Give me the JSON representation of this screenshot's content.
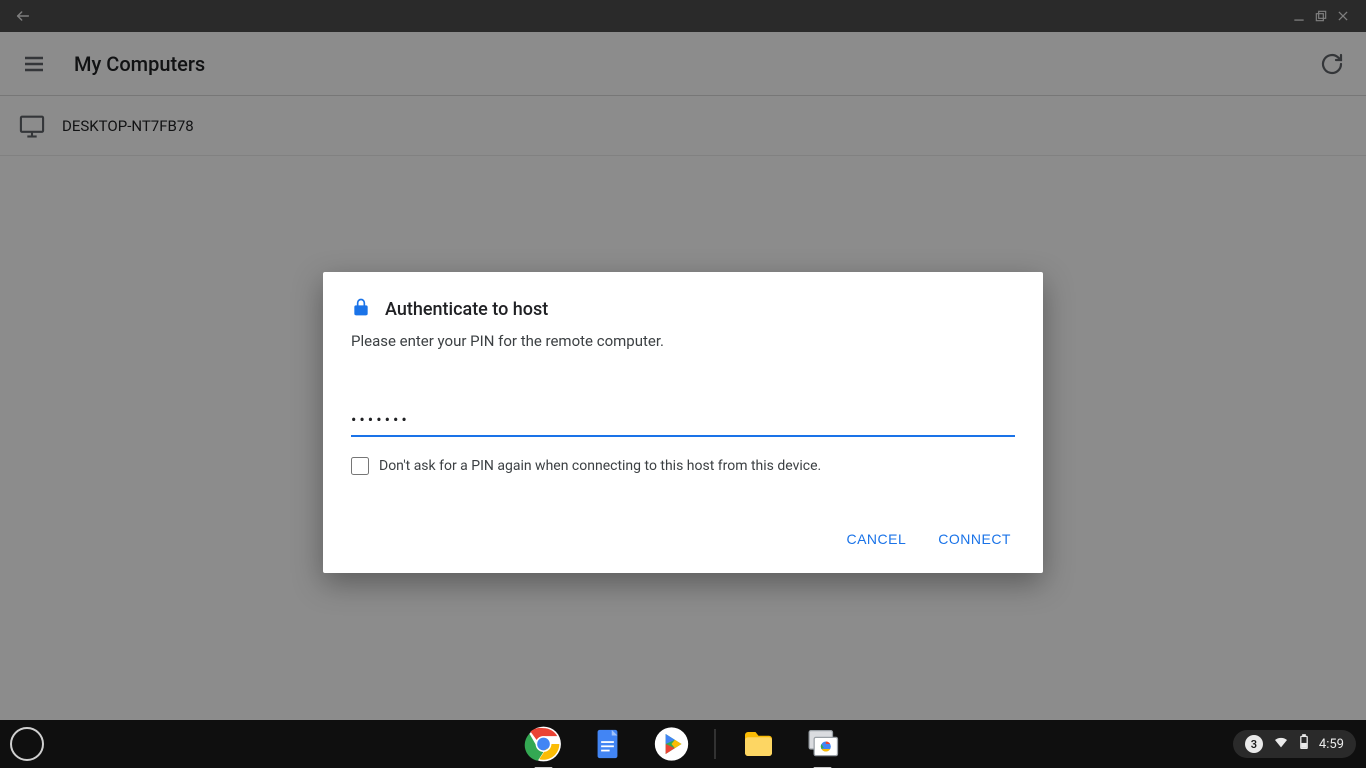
{
  "window": {
    "back": "←"
  },
  "header": {
    "title": "My Computers"
  },
  "hosts": [
    {
      "name": "DESKTOP-NT7FB78"
    }
  ],
  "dialog": {
    "title": "Authenticate to host",
    "subtitle": "Please enter your PIN for the remote computer.",
    "pin_value": "•••••••",
    "remember_label": "Don't ask for a PIN again when connecting to this host from this device.",
    "cancel_label": "CANCEL",
    "connect_label": "CONNECT"
  },
  "shelf": {
    "notification_count": "3",
    "clock": "4:59"
  }
}
